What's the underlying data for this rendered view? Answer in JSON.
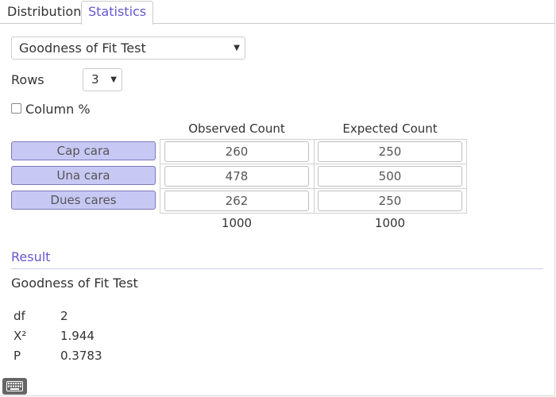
{
  "tabs": [
    {
      "label": "Distribution",
      "active": false
    },
    {
      "label": "Statistics",
      "active": true
    }
  ],
  "test_select": {
    "value": "Goodness of Fit Test"
  },
  "rows": {
    "label": "Rows",
    "value": "3"
  },
  "column_percent": {
    "label": "Column %",
    "checked": false
  },
  "table": {
    "headers": [
      "Observed Count",
      "Expected Count"
    ],
    "rows": [
      {
        "label": "Cap cara",
        "observed": "260",
        "expected": "250"
      },
      {
        "label": "Una cara",
        "observed": "478",
        "expected": "500"
      },
      {
        "label": "Dues cares",
        "observed": "262",
        "expected": "250"
      }
    ],
    "totals": [
      "1000",
      "1000"
    ]
  },
  "result": {
    "heading": "Result",
    "name": "Goodness of Fit Test",
    "stats": [
      {
        "label": "df",
        "value": "2"
      },
      {
        "label": "X²",
        "value": "1.944"
      },
      {
        "label": "P",
        "value": "0.3783"
      }
    ]
  },
  "colors": {
    "accent": "#6557d2",
    "row_label_bg": "#c8c8f5"
  },
  "icons": {
    "keyboard": "keyboard-icon"
  }
}
